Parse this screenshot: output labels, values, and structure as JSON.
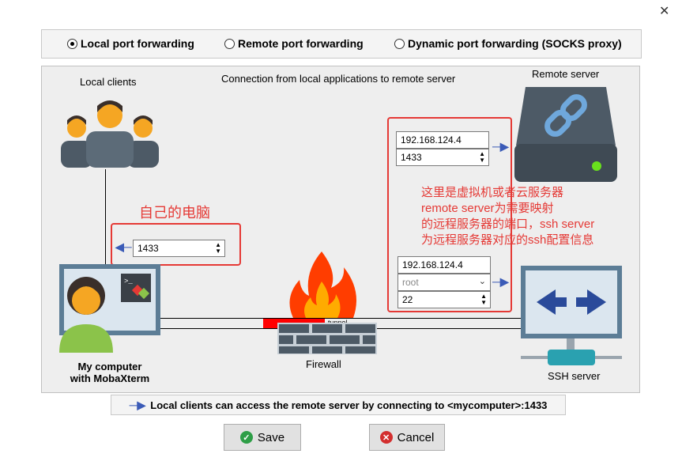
{
  "window": {
    "close_glyph": "✕"
  },
  "modes": [
    {
      "label": "Local port forwarding",
      "selected": true
    },
    {
      "label": "Remote port forwarding",
      "selected": false
    },
    {
      "label": "Dynamic port forwarding (SOCKS proxy)",
      "selected": false
    }
  ],
  "diagram": {
    "local_clients": "Local clients",
    "connection_caption": "Connection from local applications to remote server",
    "remote_server": "Remote server",
    "my_computer_line1": "My computer",
    "my_computer_line2": "with MobaXterm",
    "firewall": "Firewall",
    "tunnel": "tunnel",
    "ssh_server": "SSH server",
    "local_port": "1433",
    "remote_host": "192.168.124.4",
    "remote_port": "1433",
    "ssh_host": "192.168.124.4",
    "ssh_user": "root",
    "ssh_port": "22"
  },
  "annotations": {
    "self_computer": "自己的电脑",
    "note_line1": "这里是虚拟机或者云服务器",
    "note_line2": "remote server为需要映射",
    "note_line3": "的远程服务器的端口，ssh server",
    "note_line4": "为远程服务器对应的ssh配置信息"
  },
  "info": "Local clients can access the remote server by connecting to <mycomputer>:1433",
  "buttons": {
    "save": "Save",
    "cancel": "Cancel"
  },
  "colors": {
    "accent_red": "#e53935",
    "arrow_blue": "#3b5bb7",
    "server_dark": "#4d5a66",
    "monitor_blue": "#5c7d96"
  }
}
